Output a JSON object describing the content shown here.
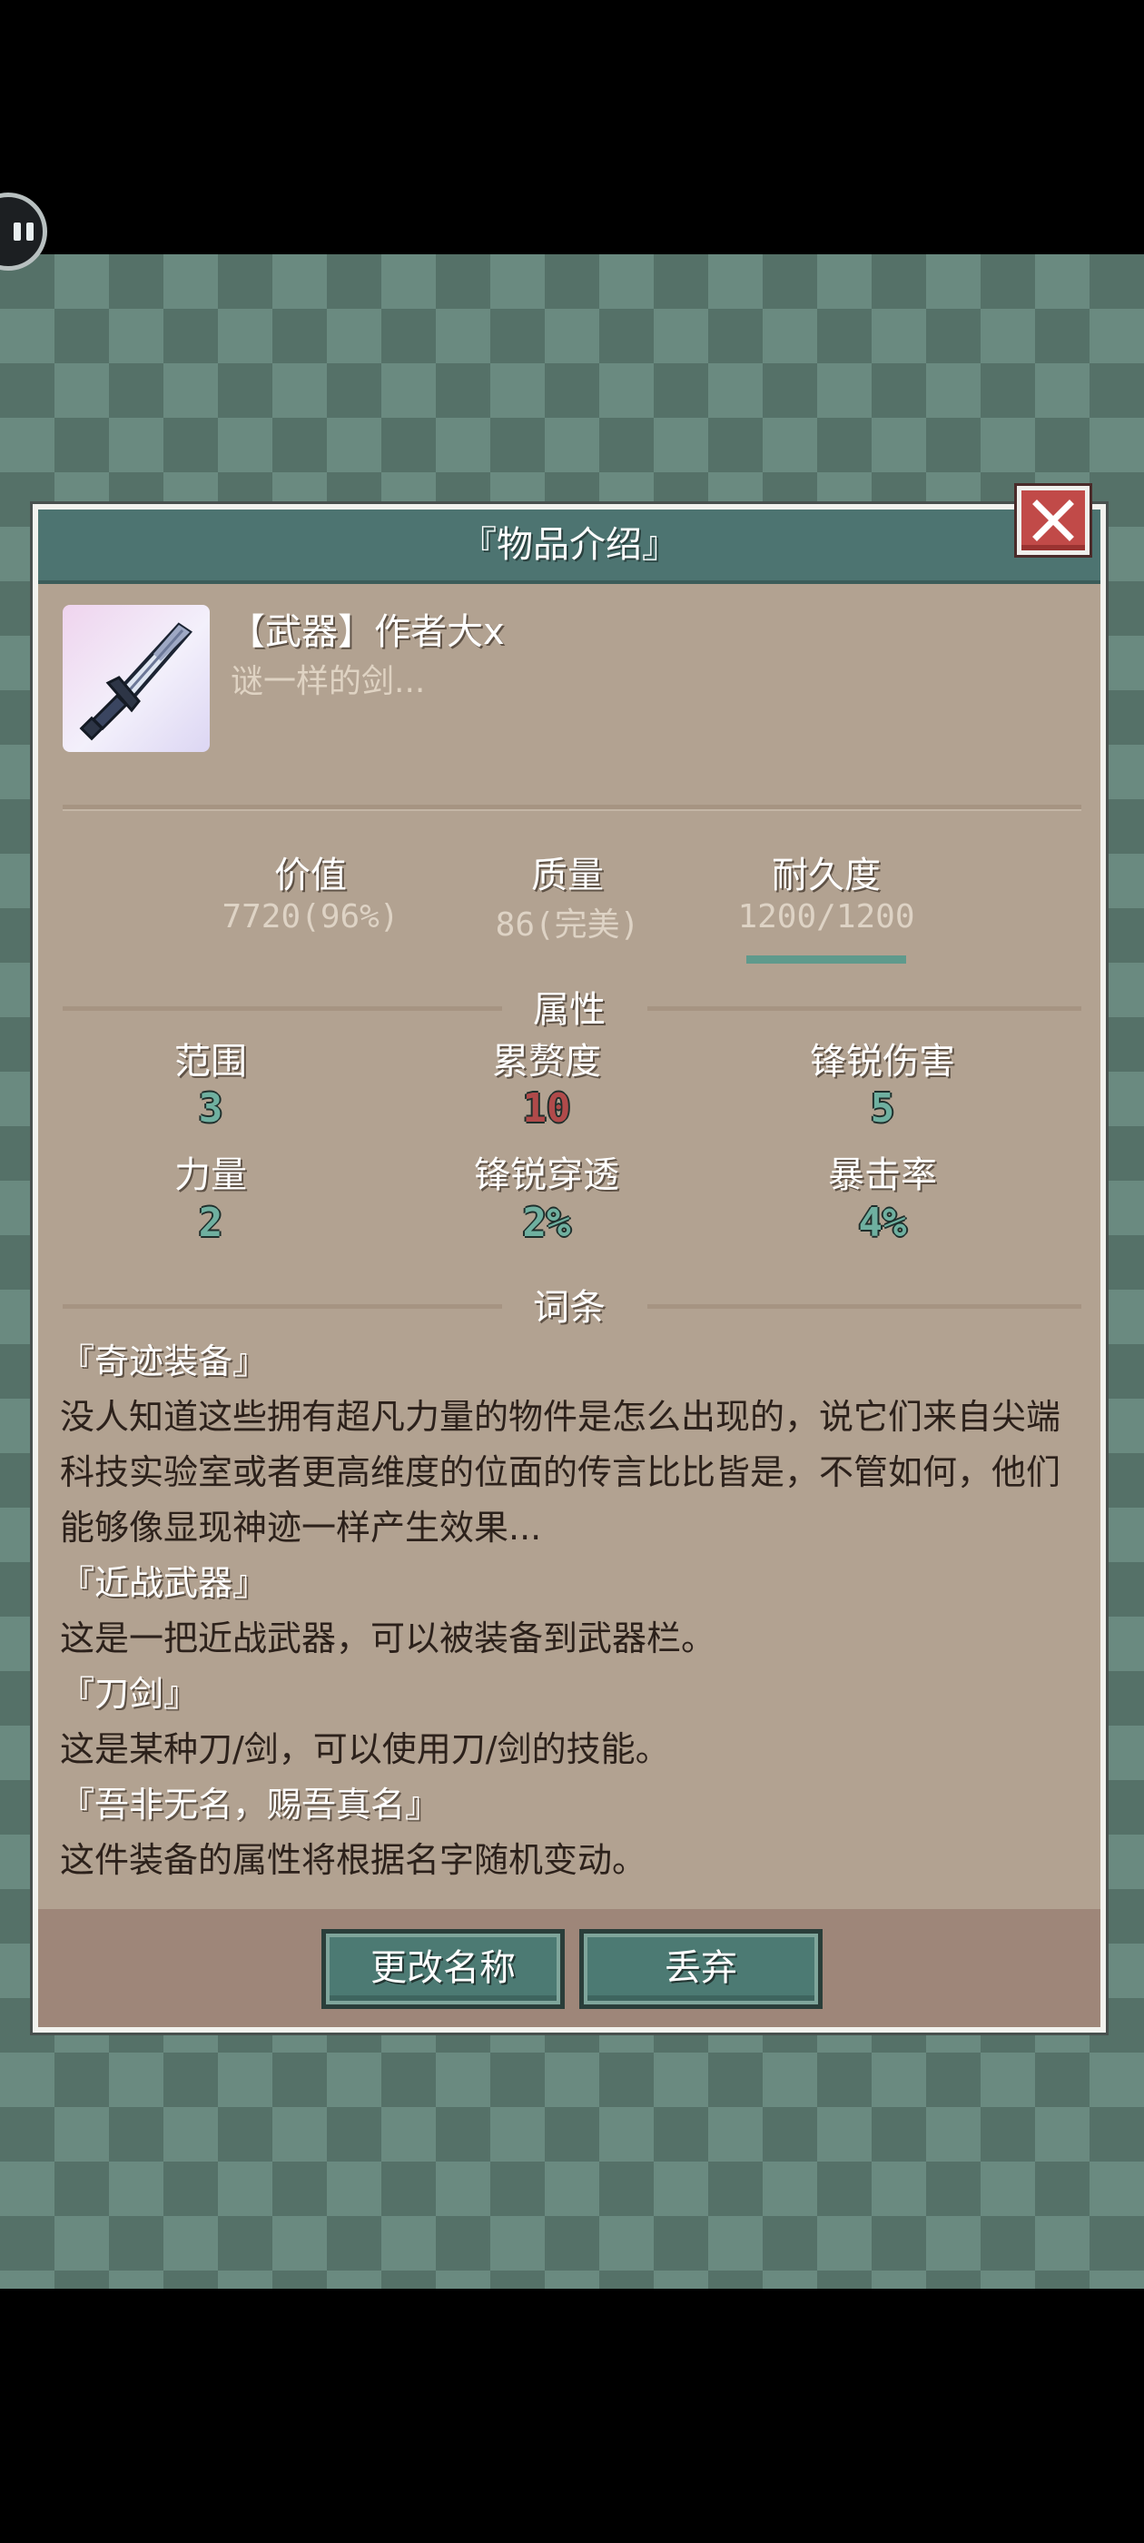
{
  "dialog": {
    "title": "『物品介绍』"
  },
  "item": {
    "name": "【武器】作者大x",
    "description": "谜一样的剑...",
    "icon": "sword-icon"
  },
  "stats": [
    {
      "label": "价值",
      "value": "7720(96%)"
    },
    {
      "label": "质量",
      "value": "86(完美)"
    },
    {
      "label": "耐久度",
      "value": "1200/1200",
      "fill_fraction": 1.0
    }
  ],
  "attributes": {
    "section_title": "属性",
    "items": [
      {
        "label": "范围",
        "value": "3",
        "color": "#6fb0a0"
      },
      {
        "label": "累赘度",
        "value": "10",
        "color": "#b04a4a"
      },
      {
        "label": "锋锐伤害",
        "value": "5",
        "color": "#6fb0a0"
      },
      {
        "label": "力量",
        "value": "2",
        "color": "#6fb0a0"
      },
      {
        "label": "锋锐穿透",
        "value": "2%",
        "color": "#6fb0a0"
      },
      {
        "label": "暴击率",
        "value": "4%",
        "color": "#6fb0a0"
      }
    ]
  },
  "traits": {
    "section_title": "词条",
    "items": [
      {
        "title": "『奇迹装备』",
        "text": "没人知道这些拥有超凡力量的物件是怎么出现的，说它们来自尖端科技实验室或者更高维度的位面的传言比比皆是，不管如何，他们能够像显现神迹一样产生效果..."
      },
      {
        "title": "『近战武器』",
        "text": "这是一把近战武器，可以被装备到武器栏。"
      },
      {
        "title": "『刀剑』",
        "text": "这是某种刀/剑，可以使用刀/剑的技能。"
      },
      {
        "title": "『吾非无名，赐吾真名』",
        "text": "这件装备的属性将根据名字随机变动。"
      }
    ]
  },
  "buttons": {
    "rename": "更改名称",
    "discard": "丢弃"
  },
  "colors": {
    "header": "#4d7471",
    "panel": "#b2a291",
    "footer": "#9e8679",
    "close": "#c14a48",
    "button": "#4c7a73"
  }
}
